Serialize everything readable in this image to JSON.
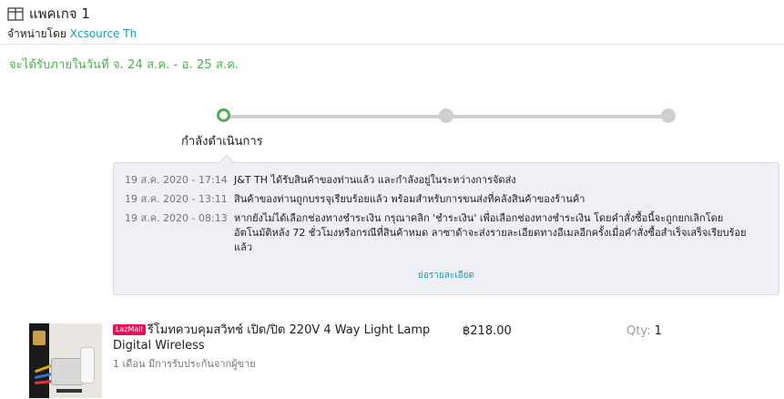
{
  "package": {
    "title": "แพคเกจ 1",
    "sold_by_label": "จำหน่ายโดย",
    "seller": "Xcsource Th"
  },
  "delivery_estimate": "จะได้รับภายในวันที่ จ. 24 ส.ค. - อ. 25 ส.ค.",
  "progress": {
    "current_step_label": "กำลังดำเนินการ",
    "steps_total": 3,
    "active_step": 1
  },
  "tracking": {
    "events": [
      {
        "time": "19 ส.ค. 2020 - 17:14",
        "desc": "J&T TH ได้รับสินค้าของท่านแล้ว และกำลังอยู่ในระหว่างการจัดส่ง"
      },
      {
        "time": "19 ส.ค. 2020 - 13:11",
        "desc": "สินค้าของท่านถูกบรรจุเรียบร้อยแล้ว พร้อมสำหรับการขนส่งที่คลังสินค้าของร้านค้า"
      },
      {
        "time": "19 ส.ค. 2020 - 08:13",
        "desc": "หากยังไม่ได้เลือกช่องทางชำระเงิน กรุณาคลิก 'ชำระเงิน' เพื่อเลือกช่องทางชำระเงิน โดยคำสั่งซื้อนี้จะถูกยกเลิกโดยอัตโนมัติหลัง 72 ชั่วโมงหรือกรณีที่สินค้าหมด ลาซาด้าจะส่งรายละเอียดทางอีเมลอีกครั้งเมื่อคำสั่งซื้อสำเร็จเสร็จเรียบร้อยแล้ว"
      }
    ],
    "details_link": "ย่อรายละเอียด"
  },
  "item": {
    "badge": "LazMall",
    "name": "รีโมทควบคุมสวิทช์ เปิด/ปิด 220V 4 Way Light Lamp Digital Wireless",
    "warranty": "1 เดือน มีการรับประกันจากผู้ขาย",
    "price": "฿218.00",
    "qty_label": "Qty:",
    "qty": "1"
  },
  "colors": {
    "accent_green": "#4caf50",
    "link_blue": "#1a9cb7",
    "lazmall_pink": "#e0155b"
  }
}
